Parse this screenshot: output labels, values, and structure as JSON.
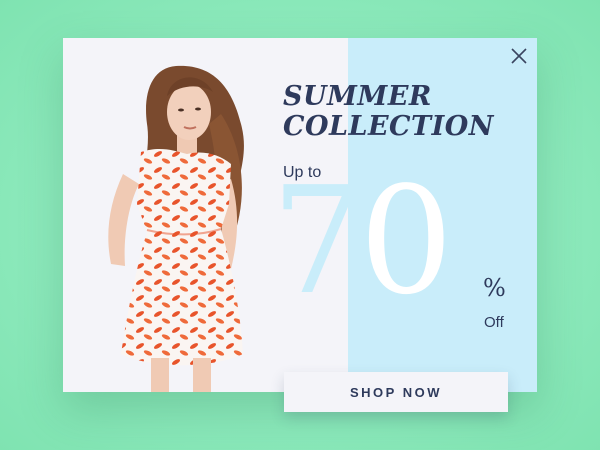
{
  "popup": {
    "headline_line1": "SUMMER",
    "headline_line2": "COLLECTION",
    "upto_label": "Up to",
    "discount_digit1": "7",
    "discount_digit2": "0",
    "percent_sign": "%",
    "off_label": "Off",
    "cta_label": "SHOP NOW",
    "close_icon": "close-icon"
  },
  "colors": {
    "background": "#8eeabd",
    "panel_left": "#f4f4f9",
    "panel_right": "#c9edfa",
    "text_dark": "#2e3a5c",
    "dress_pattern": "#e8542b"
  }
}
